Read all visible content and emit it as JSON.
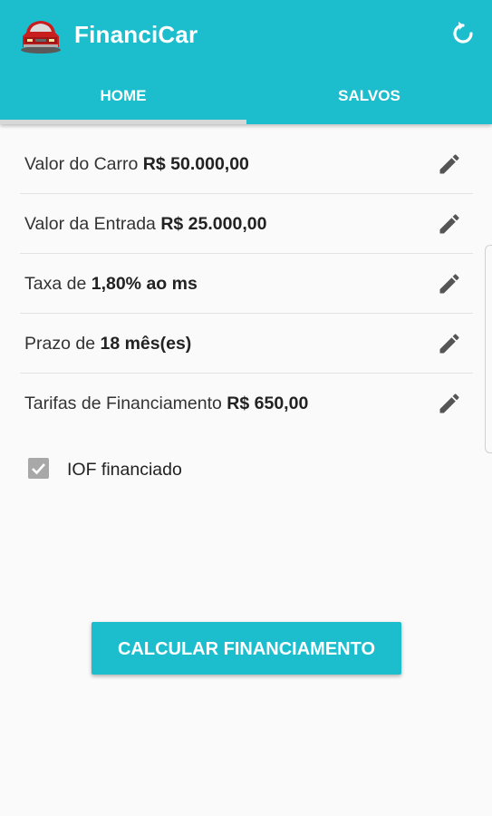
{
  "app": {
    "title": "FinanciCar",
    "icon": "car-icon",
    "accent_color": "#1cbdcd"
  },
  "toolbar": {
    "refresh_icon": "refresh-icon"
  },
  "tabs": [
    {
      "label": "HOME",
      "selected": true
    },
    {
      "label": "SALVOS",
      "selected": false
    }
  ],
  "fields": [
    {
      "label": "Valor do Carro",
      "value": "R$ 50.000,00",
      "icon": "pencil-icon"
    },
    {
      "label": "Valor da Entrada",
      "value": "R$ 25.000,00",
      "icon": "pencil-icon"
    },
    {
      "label": "Taxa de",
      "value": "1,80% ao ms",
      "icon": "pencil-icon"
    },
    {
      "label": "Prazo de",
      "value": "18 mês(es)",
      "icon": "pencil-icon"
    },
    {
      "label": "Tarifas de Financiamento",
      "value": "R$ 650,00",
      "icon": "pencil-icon"
    }
  ],
  "iof": {
    "label": "IOF financiado",
    "checked": true
  },
  "calculate_button": {
    "label": "CALCULAR FINANCIAMENTO"
  }
}
